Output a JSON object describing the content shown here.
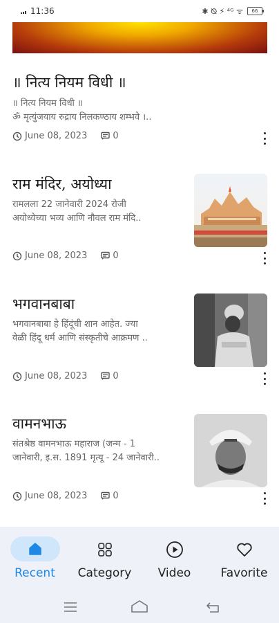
{
  "status_bar": {
    "time": "11:36",
    "icons": "✱ ⦰ ⚡ ⁴ᴳ ᯤ",
    "battery": "66"
  },
  "articles": [
    {
      "title": "॥ नित्य नियम विधी ॥",
      "excerpt": [
        "॥ नित्य नियम विधी ॥",
        "ॐ मृत्युंजयाय रुद्राय निलकण्ठाय शम्भवे ।.."
      ],
      "date": "June 08, 2023",
      "comments": "0"
    },
    {
      "title": "राम मंदिर, अयोध्या",
      "excerpt": [
        "रामलला 22 जानेवारी 2024 रोजी",
        "अयोध्येच्या भव्य आणि नौवल राम मंदि.."
      ],
      "date": "June 08, 2023",
      "comments": "0"
    },
    {
      "title": "भगवानबाबा",
      "excerpt": [
        "भगवानबाबा हे हिंदूंची शान आहेत. ज्या",
        "वेळी हिंदू धर्म आणि संस्कृतीचे आक्रमण .."
      ],
      "date": "June 08, 2023",
      "comments": "0"
    },
    {
      "title": "वामनभाऊ",
      "excerpt": [
        "संतश्रेष्ठ वामनभाऊ महाराज (जन्म - 1",
        "जानेवारी, इ.स. 1891 मृत्यू - 24 जानेवारी.."
      ],
      "date": "June 08, 2023",
      "comments": "0"
    }
  ],
  "bottom_nav": [
    {
      "label": "Recent",
      "icon": "home-icon",
      "active": true
    },
    {
      "label": "Category",
      "icon": "grid-icon",
      "active": false
    },
    {
      "label": "Video",
      "icon": "play-circle-icon",
      "active": false
    },
    {
      "label": "Favorite",
      "icon": "heart-icon",
      "active": false
    }
  ],
  "colors": {
    "accent": "#1e88e5",
    "pill": "#cfe6fb",
    "nav_bg": "#eef2f8"
  }
}
